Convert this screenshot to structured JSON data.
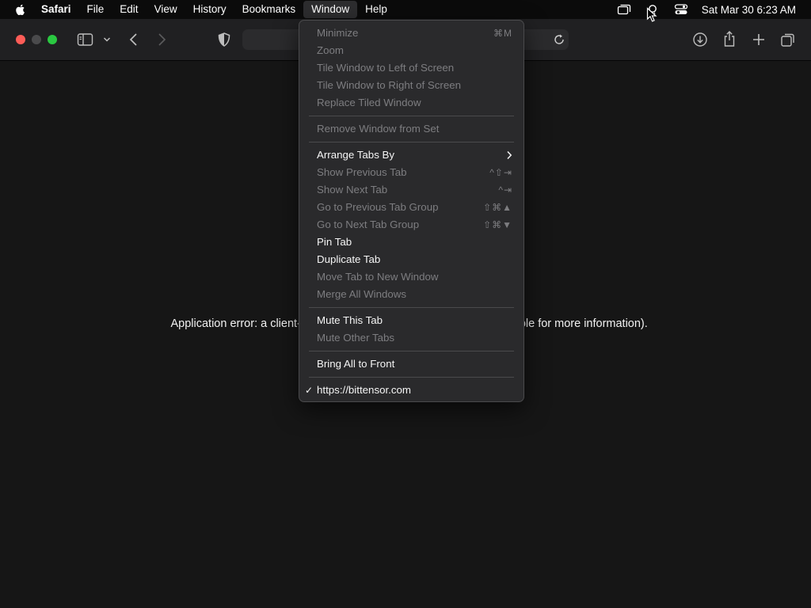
{
  "menubar": {
    "app_name": "Safari",
    "items": [
      "File",
      "Edit",
      "View",
      "History",
      "Bookmarks",
      "Window",
      "Help"
    ],
    "clock": "Sat Mar 30  6:23 AM",
    "status_icons": [
      "screen-mirroring-icon",
      "user-account-icon",
      "control-center-icon"
    ]
  },
  "toolbar": {
    "icons": [
      "sidebar-icon",
      "chevron-down-icon",
      "back-icon",
      "forward-icon",
      "privacy-shield-icon",
      "reload-icon",
      "download-icon",
      "share-icon",
      "new-tab-icon",
      "tab-overview-icon"
    ]
  },
  "content": {
    "error_left": "Application error: a client-side",
    "error_right": "nsole for more information)."
  },
  "window_menu": {
    "items": [
      {
        "label": "Minimize",
        "shortcut": "⌘M",
        "enabled": false
      },
      {
        "label": "Zoom",
        "shortcut": "",
        "enabled": false
      },
      {
        "label": "Tile Window to Left of Screen",
        "shortcut": "",
        "enabled": false
      },
      {
        "label": "Tile Window to Right of Screen",
        "shortcut": "",
        "enabled": false
      },
      {
        "label": "Replace Tiled Window",
        "shortcut": "",
        "enabled": false
      },
      {
        "label": "Remove Window from Set",
        "shortcut": "",
        "enabled": false
      },
      {
        "label": "Arrange Tabs By",
        "shortcut": "",
        "enabled": true,
        "submenu": true
      },
      {
        "label": "Show Previous Tab",
        "shortcut": "^⇧⇥",
        "enabled": false
      },
      {
        "label": "Show Next Tab",
        "shortcut": "^⇥",
        "enabled": false
      },
      {
        "label": "Go to Previous Tab Group",
        "shortcut": "⇧⌘▲",
        "enabled": false
      },
      {
        "label": "Go to Next Tab Group",
        "shortcut": "⇧⌘▼",
        "enabled": false
      },
      {
        "label": "Pin Tab",
        "shortcut": "",
        "enabled": true
      },
      {
        "label": "Duplicate Tab",
        "shortcut": "",
        "enabled": true
      },
      {
        "label": "Move Tab to New Window",
        "shortcut": "",
        "enabled": false
      },
      {
        "label": "Merge All Windows",
        "shortcut": "",
        "enabled": false
      },
      {
        "label": "Mute This Tab",
        "shortcut": "",
        "enabled": true
      },
      {
        "label": "Mute Other Tabs",
        "shortcut": "",
        "enabled": false
      },
      {
        "label": "Bring All to Front",
        "shortcut": "",
        "enabled": true
      },
      {
        "label": "https://bittensor.com",
        "shortcut": "",
        "enabled": true,
        "checked": true
      }
    ]
  },
  "colors": {
    "background": "#161616",
    "menu_bg": "#2a2a2c",
    "enabled_text": "#f5f5f5",
    "disabled_text": "#7d7d80",
    "traffic_red": "#fd5c57",
    "traffic_green": "#2ac841"
  }
}
